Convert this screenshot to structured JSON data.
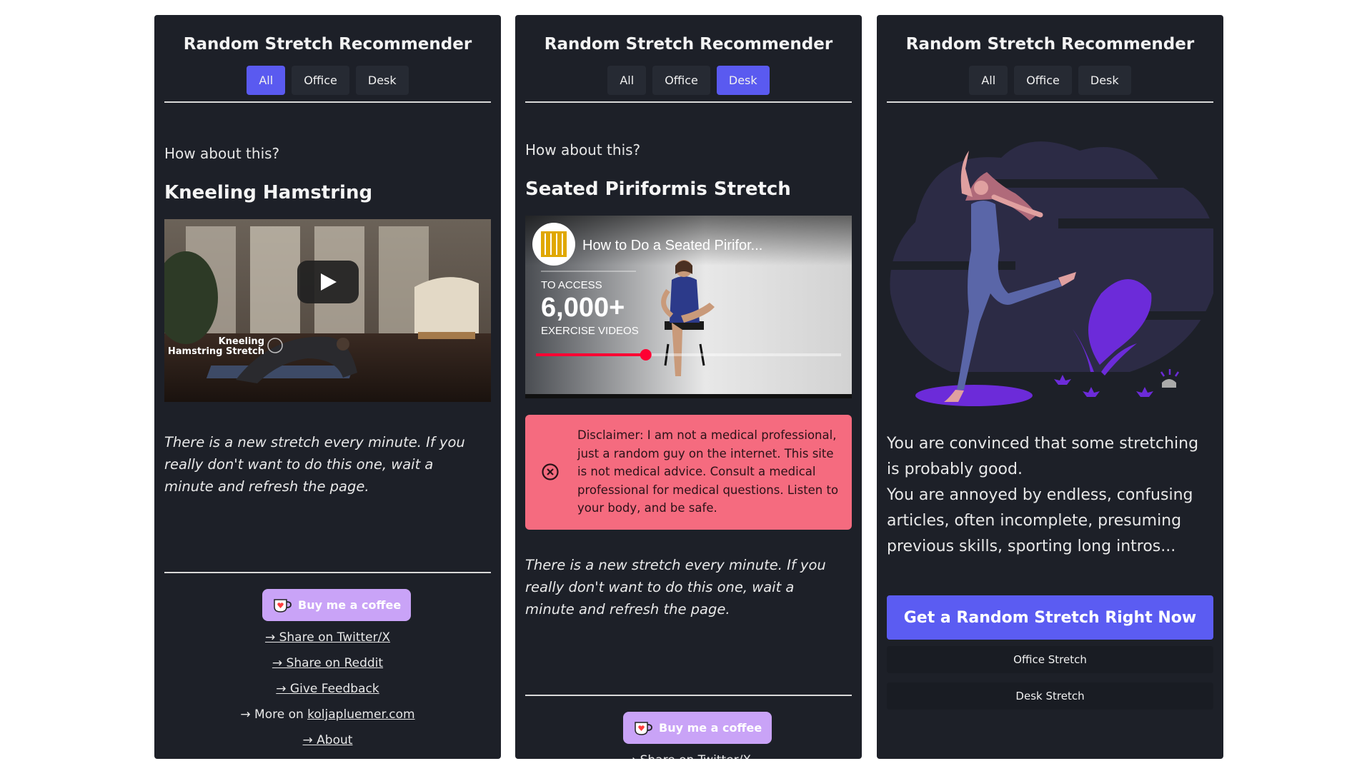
{
  "panels": [
    {
      "title": "Random Stretch Recommender",
      "tabs": [
        "All",
        "Office",
        "Desk"
      ],
      "active_tab": "All",
      "prompt": "How about this?",
      "stretch_name": "Kneeling Hamstring",
      "video_overlay": [
        "Kneeling",
        "Hamstring Stretch"
      ],
      "note": "There is a new stretch every minute. If you really don't want to do this one, wait a minute and refresh the page.",
      "coffee": "Buy me a coffee",
      "links": {
        "twitter": "→ Share on Twitter/X",
        "reddit": "→ Share on Reddit",
        "feedback": "→ Give Feedback",
        "more_prefix": "→ More on ",
        "more_site": "koljapluemer.com",
        "about": "→ About"
      }
    },
    {
      "title": "Random Stretch Recommender",
      "tabs": [
        "All",
        "Office",
        "Desk"
      ],
      "active_tab": "Desk",
      "prompt": "How about this?",
      "stretch_name": "Seated Piriformis Stretch",
      "video": {
        "title": "How to Do a Seated Pirifor...",
        "access_line": "TO ACCESS",
        "big_number": "6,000+",
        "exercise_line": "EXERCISE VIDEOS",
        "progress": 0.36
      },
      "disclaimer": "Disclaimer: I am not a medical professional, just a random guy on the internet. This site is not medical advice. Consult a medical professional for medical questions. Listen to your body, and be safe.",
      "note": "There is a new stretch every minute. If you really don't want to do this one, wait a minute and refresh the page.",
      "coffee": "Buy me a coffee",
      "links": {
        "twitter": "→ Share on Twitter/X"
      }
    },
    {
      "title": "Random Stretch Recommender",
      "tabs": [
        "All",
        "Office",
        "Desk"
      ],
      "active_tab": "",
      "intro_1": "You are convinced that some stretching is probably good.",
      "intro_2": "You are annoyed by endless, confusing articles, often incomplete, presuming previous skills, sporting long intros...",
      "cta": "Get a Random Stretch Right Now",
      "office_btn": "Office Stretch",
      "desk_btn": "Desk Stretch"
    }
  ],
  "colors": {
    "panel_bg": "#1d2028",
    "accent": "#5a5af0",
    "disclaimer_bg": "#f56b7f",
    "coffee_bg": "#c9a3f7",
    "illustration_purple": "#6c2bd9"
  }
}
